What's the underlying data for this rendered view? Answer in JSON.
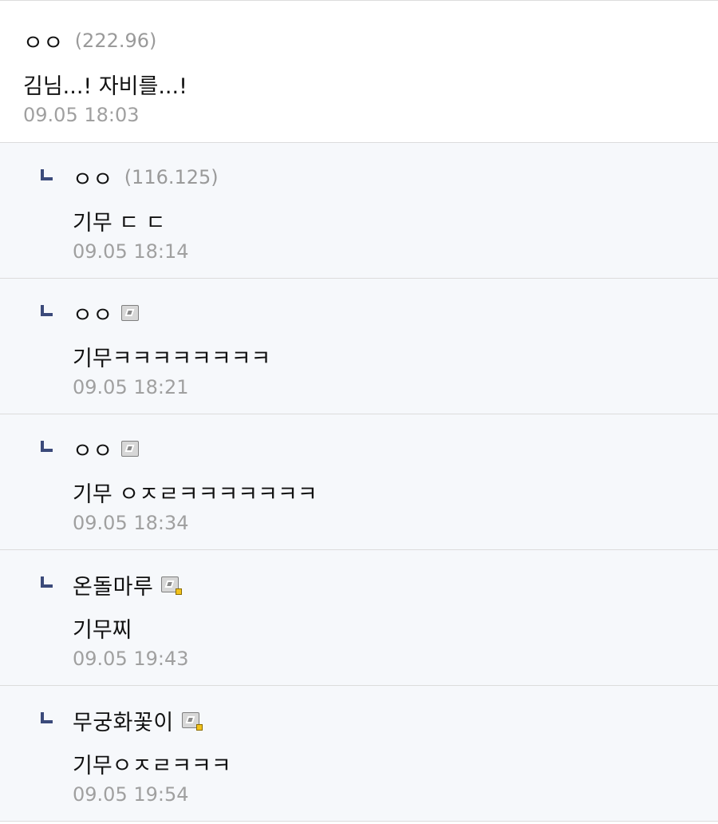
{
  "comments": [
    {
      "nick": "ㅇㅇ",
      "ip": "(222.96)",
      "text": "김님...! 자비를...!",
      "date": "09.05 18:03"
    },
    {
      "nick": "ㅇㅇ",
      "ip": "(116.125)",
      "text": "기무 ㄷ ㄷ",
      "date": "09.05 18:14"
    },
    {
      "nick": "ㅇㅇ",
      "badge": "fixed-nick-icon",
      "text": "기무ㅋㅋㅋㅋㅋㅋㅋㅋ",
      "date": "09.05 18:21"
    },
    {
      "nick": "ㅇㅇ",
      "badge": "fixed-nick-icon",
      "text": "기무 ㅇㅈㄹㅋㅋㅋㅋㅋㅋㅋ",
      "date": "09.05 18:34"
    },
    {
      "nick": "온돌마루",
      "badge": "gold-fixed-nick-icon",
      "text": "기무찌",
      "date": "09.05 19:43"
    },
    {
      "nick": "무궁화꽃이",
      "badge": "gold-fixed-nick-icon",
      "text": "기무ㅇㅈㄹㅋㅋㅋ",
      "date": "09.05 19:54"
    }
  ],
  "colors": {
    "reply_bg": "#f6f8fb",
    "reply_arrow": "#3b4a7a",
    "muted": "#a0a0a0"
  }
}
